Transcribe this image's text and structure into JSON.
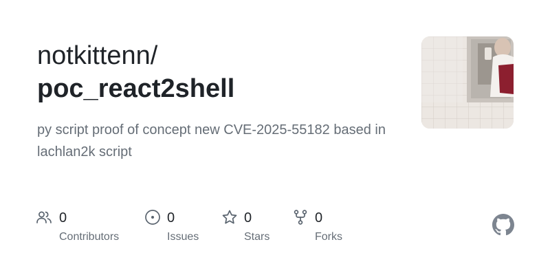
{
  "repo": {
    "owner": "notkittenn/",
    "name": "poc_react2shell",
    "description": "py script proof of concept new CVE-2025-55182 based in lachlan2k script"
  },
  "stats": {
    "contributors": {
      "count": "0",
      "label": "Contributors",
      "icon": "people-icon"
    },
    "issues": {
      "count": "0",
      "label": "Issues",
      "icon": "issue-opened-icon"
    },
    "stars": {
      "count": "0",
      "label": "Stars",
      "icon": "star-icon"
    },
    "forks": {
      "count": "0",
      "label": "Forks",
      "icon": "fork-icon"
    }
  },
  "avatar": {
    "kind": "user-photo"
  },
  "branding": {
    "icon": "github-mark-icon"
  },
  "colors": {
    "text_primary": "#1f2328",
    "text_secondary": "#656d76",
    "icon_gray": "#59636e",
    "github_mark": "#7d8590"
  }
}
